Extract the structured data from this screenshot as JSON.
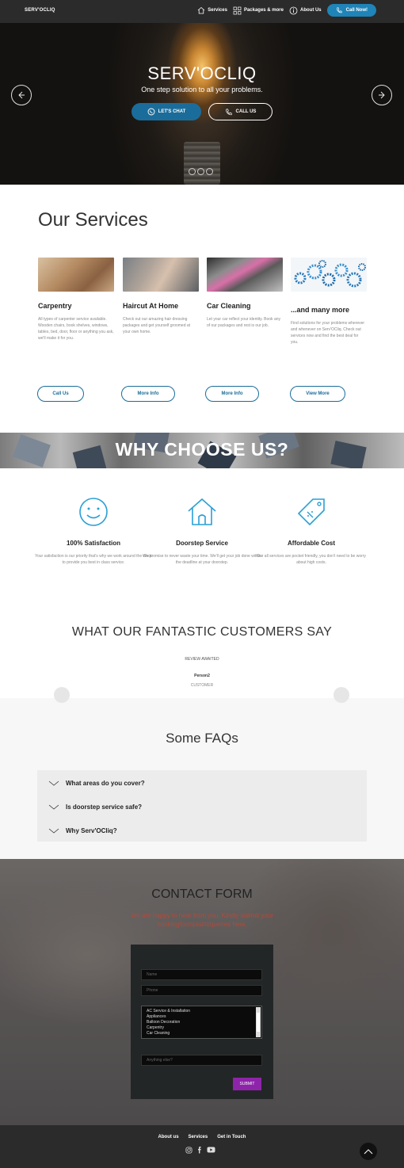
{
  "nav": {
    "brand": "SERV'OCLIQ",
    "links": [
      "Services",
      "Packages & more",
      "About Us"
    ],
    "call_now": "Call Now!"
  },
  "hero": {
    "title": "SERV'OCLIQ",
    "subtitle": "One step solution to all your problems.",
    "chat_label": "LET'S CHAT",
    "call_label": "CALL US",
    "icons": [
      "arrow-left-icon",
      "arrow-right-icon",
      "whatsapp-icon",
      "phone-icon"
    ]
  },
  "services": {
    "title": "Our Services",
    "cards": [
      {
        "title": "Carpentry",
        "desc": "All types of carpenter service available. Wooden chairs, book shelves, windows, tables, bed, door, floor or anything you ask, we'll make it for you.",
        "button": "Call Us"
      },
      {
        "title": "Haircut At Home",
        "desc": "Check out our amazing hair dressing packages and get yourself groomed at your own home.",
        "button": "More Info"
      },
      {
        "title": "Car Cleaning",
        "desc": "Let your car reflect your identity. Book any of our packages and rest is our job.",
        "button": "More Info"
      },
      {
        "title": "...and many more",
        "desc": "Find solutions for your problems wherever and whenever on Serv'OCliq. Check out services now and find the best deal for you.",
        "button": "View More"
      }
    ]
  },
  "why": {
    "title": "WHY CHOOSE US?",
    "features": [
      {
        "title": "100%  Satisfaction",
        "desc": "Your satisfaction is our priority that's why we work around the clock to provide you best in class service.",
        "icon": "smiley-icon"
      },
      {
        "title": "Doorstep Service",
        "desc": "We promise to never waste your time. We'll get your job done within the deadline at your doorstep.",
        "icon": "house-icon"
      },
      {
        "title": "Affordable Cost",
        "desc": "Our all services are pocket friendly, you don't need to be worry about high costs.",
        "icon": "price-tag-icon"
      }
    ]
  },
  "testimonials": {
    "title": "WHAT OUR FANTASTIC CUSTOMERS SAY",
    "review": "REVIEW AWAITED",
    "person": "Person2",
    "role": "CUSTOMER"
  },
  "faq": {
    "title": "Some FAQs",
    "items": [
      "What areas do you cover?",
      "Is doorstep service safe?",
      "Why Serv'OCliq?"
    ]
  },
  "contact": {
    "title": "CONTACT FORM",
    "subtitle": "We are happy to hear from you. Kindly submit your booking/complaint/queries here.",
    "name_placeholder": "Name",
    "phone_placeholder": "Phone",
    "options": [
      "AC Service & Installation",
      "Appliances",
      "Balloon Decoration",
      "Carpentry",
      "Car Cleaning"
    ],
    "anything_placeholder": "Anything else?",
    "submit": "SUBMIT"
  },
  "footer": {
    "links": [
      "About us",
      "Services",
      "Get in Touch"
    ],
    "social": [
      "instagram-icon",
      "facebook-icon",
      "youtube-icon"
    ]
  },
  "colors": {
    "nav_bg": "#2b2b2b",
    "accent_blue": "#1f84b8",
    "submit_purple": "#8e24aa",
    "contact_subtitle": "#b24a3a"
  }
}
